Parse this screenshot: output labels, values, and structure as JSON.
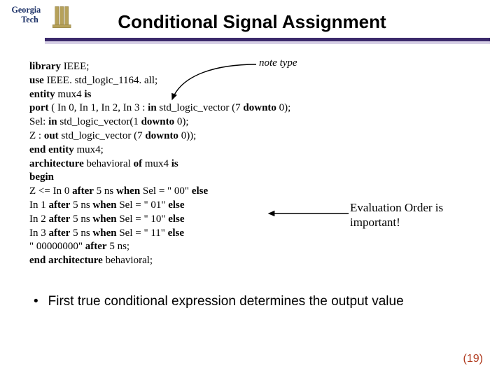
{
  "logo": {
    "line1": "Georgia",
    "line2": "Tech"
  },
  "title": "Conditional Signal Assignment",
  "annotations": {
    "note_type": "note type",
    "eval_order_l1": "Evaluation Order is",
    "eval_order_l2": "important!"
  },
  "code": {
    "l1_b1": "library",
    "l1_t1": " IEEE;",
    "l2_b1": "use",
    "l2_t1": " IEEE. std_logic_1164. all;",
    "l3_b1": "entity",
    "l3_t1": " mux4 ",
    "l3_b2": "is",
    "l4_b1": "port",
    "l4_t1": " ( In 0, In 1, In 2, In 3 : ",
    "l4_b2": "in",
    "l4_t2": " std_logic_vector (7 ",
    "l4_b3": "downto",
    "l4_t3": " 0);",
    "l5_t1": "Sel: ",
    "l5_b1": "in",
    "l5_t2": " std_logic_vector(1 ",
    "l5_b2": "downto",
    "l5_t3": " 0);",
    "l6_t1": "Z : ",
    "l6_b1": "out",
    "l6_t2": " std_logic_vector (7 ",
    "l6_b2": "downto",
    "l6_t3": " 0));",
    "l7_b1": "end entity",
    "l7_t1": " mux4;",
    "l8_b1": "architecture",
    "l8_t1": " behavioral ",
    "l8_b2": "of",
    "l8_t2": " mux4 ",
    "l8_b3": "is",
    "l9_b1": "begin",
    "l10_t1": "Z <= In 0 ",
    "l10_b1": "after",
    "l10_t2": " 5 ns ",
    "l10_b2": "when",
    "l10_t3": " Sel = \" 00\" ",
    "l10_b3": "else",
    "l11_t1": "In 1 ",
    "l11_b1": "after",
    "l11_t2": " 5 ns ",
    "l11_b2": "when",
    "l11_t3": " Sel = \" 01\" ",
    "l11_b3": "else",
    "l12_t1": "In 2 ",
    "l12_b1": "after",
    "l12_t2": " 5 ns ",
    "l12_b2": "when",
    "l12_t3": " Sel = \" 10\" ",
    "l12_b3": "else",
    "l13_t1": "In 3 ",
    "l13_b1": "after",
    "l13_t2": " 5 ns ",
    "l13_b2": "when",
    "l13_t3": " Sel = \" 11\" ",
    "l13_b3": "else",
    "l14_t1": "\" 00000000\" ",
    "l14_b1": "after",
    "l14_t2": " 5 ns;",
    "l15_b1": "end architecture",
    "l15_t1": " behavioral;"
  },
  "bullet": {
    "dot": "•",
    "text": "First true conditional expression determines the output value"
  },
  "pagenum": "(19)"
}
